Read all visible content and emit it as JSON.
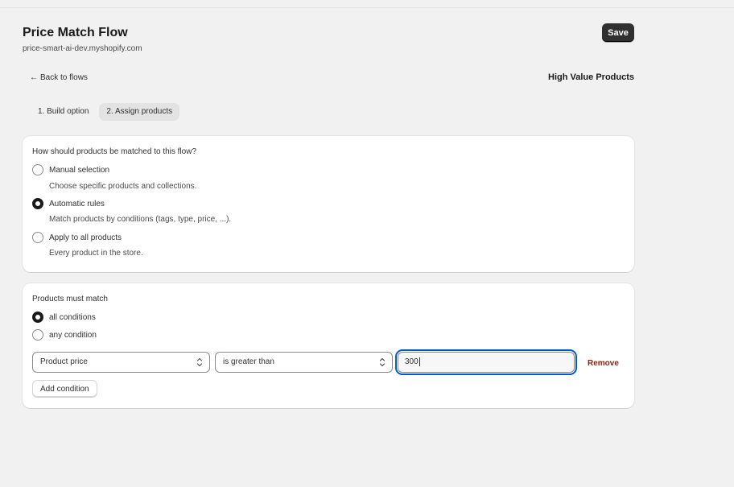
{
  "header": {
    "title": "Price Match Flow",
    "subtitle": "price-smart-ai-dev.myshopify.com",
    "save_label": "Save"
  },
  "nav": {
    "back_arrow": "←",
    "back_label": "Back to flows",
    "flow_name": "High Value Products"
  },
  "tabs": [
    {
      "label": "1. Build option",
      "active": false
    },
    {
      "label": "2. Assign products",
      "active": true
    }
  ],
  "matching": {
    "question": "How should products be matched to this flow?",
    "options": [
      {
        "label": "Manual selection",
        "help": "Choose specific products and collections.",
        "checked": false
      },
      {
        "label": "Automatic rules",
        "help": "Match products by conditions (tags, type, price, ...).",
        "checked": true
      },
      {
        "label": "Apply to all products",
        "help": "Every product in the store.",
        "checked": false
      }
    ]
  },
  "conditions": {
    "heading": "Products must match",
    "mode_options": [
      {
        "label": "all conditions",
        "checked": true
      },
      {
        "label": "any condition",
        "checked": false
      }
    ],
    "rule": {
      "field": "Product price",
      "operator": "is greater than",
      "value": "300",
      "remove_label": "Remove"
    },
    "add_label": "Add condition"
  },
  "colors": {
    "accent": "#303030",
    "focus": "#005bd3",
    "critical": "#8e1f0b",
    "background": "#f1f1f1"
  },
  "icons": {
    "select_chevron": "chevron-up-down-icon"
  }
}
